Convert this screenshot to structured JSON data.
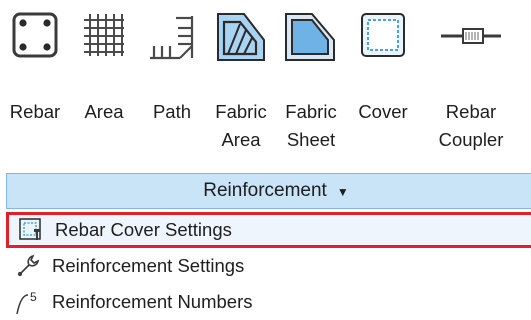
{
  "ribbon": {
    "tools": [
      {
        "id": "rebar",
        "label": "Rebar",
        "icon": "rebar-icon"
      },
      {
        "id": "area",
        "label": "Area",
        "icon": "area-icon"
      },
      {
        "id": "path",
        "label": "Path",
        "icon": "path-icon"
      },
      {
        "id": "fabric-area",
        "label": "Fabric\nArea",
        "icon": "fabric-area-icon"
      },
      {
        "id": "fabric-sheet",
        "label": "Fabric\nSheet",
        "icon": "fabric-sheet-icon"
      },
      {
        "id": "cover",
        "label": "Cover",
        "icon": "cover-icon"
      },
      {
        "id": "rebar-coupler",
        "label": "Rebar\nCoupler",
        "icon": "rebar-coupler-icon"
      }
    ],
    "panel_title": "Reinforcement",
    "panel_arrow": "▼"
  },
  "menu": {
    "items": [
      {
        "label": "Rebar Cover Settings",
        "icon": "rebar-cover-settings-icon",
        "highlighted": true
      },
      {
        "label": "Reinforcement Settings",
        "icon": "wrench-icon",
        "highlighted": false
      },
      {
        "label": "Reinforcement Numbers",
        "icon": "reinforcement-numbers-icon",
        "highlighted": false
      }
    ]
  },
  "colors": {
    "highlight_border": "#e0202a",
    "panel_bar": "#c9e3f7",
    "icon_blue": "#6fb3e6"
  }
}
